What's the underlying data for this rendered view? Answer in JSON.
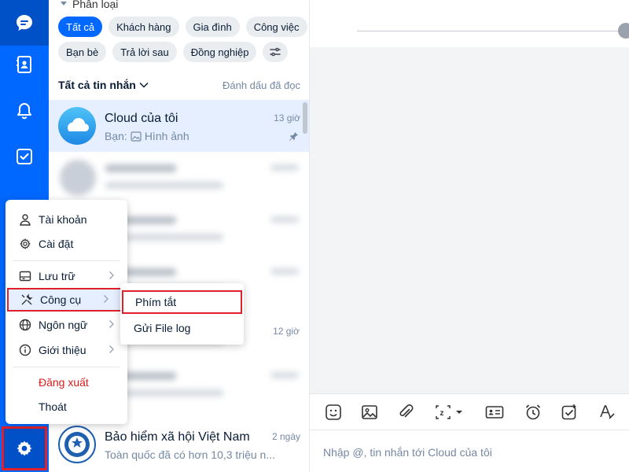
{
  "colors": {
    "brand": "#0068ff",
    "highlight": "#e0202b",
    "danger": "#d91b1b"
  },
  "rail": {
    "items": [
      {
        "name": "messages",
        "icon": "chat-bubble-icon"
      },
      {
        "name": "contacts",
        "icon": "contact-book-icon"
      },
      {
        "name": "notifications",
        "icon": "bell-icon"
      },
      {
        "name": "todo",
        "icon": "checkbox-icon"
      }
    ],
    "settings_icon": "gear-icon"
  },
  "filters": {
    "title": "Phân loại",
    "chips": [
      "Tất cả",
      "Khách hàng",
      "Gia đình",
      "Công việc",
      "Bạn bè",
      "Trả lời sau",
      "Đồng nghiệp"
    ],
    "active": "Tất cả"
  },
  "list_header": {
    "title": "Tất cả tin nhắn",
    "mark_read": "Đánh dấu đã đọc"
  },
  "conversations": [
    {
      "name": "Cloud của tôi",
      "preview_prefix": "Bạn:",
      "preview": "Hình ảnh",
      "time": "13 giờ",
      "pinned": true
    },
    {
      "time": "12 giờ"
    },
    {
      "name": "Bảo hiểm xã hội Việt Nam",
      "preview": "Toàn quốc đã có hơn 10,3 triệu n...",
      "time": "2 ngày"
    }
  ],
  "menu": {
    "account": "Tài khoản",
    "settings": "Cài đặt",
    "storage": "Lưu trữ",
    "tools": "Công cụ",
    "language": "Ngôn ngữ",
    "about": "Giới thiệu",
    "logout": "Đăng xuất",
    "quit": "Thoát"
  },
  "submenu": {
    "shortcuts": "Phím tắt",
    "send_log": "Gửi File log"
  },
  "composer": {
    "placeholder": "Nhập @, tin nhắn tới Cloud của tôi"
  },
  "toolbar_icons": [
    "sticker-icon",
    "image-icon",
    "attachment-icon",
    "screenshot-icon",
    "business-card-icon",
    "reminder-icon",
    "task-icon",
    "format-text-icon"
  ]
}
